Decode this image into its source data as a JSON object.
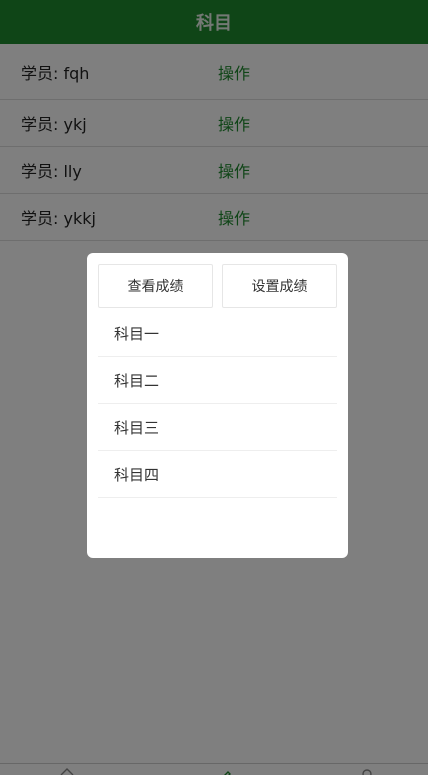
{
  "header": {
    "title": "科目"
  },
  "students": [
    {
      "name": "学员: fqh",
      "action": "操作"
    },
    {
      "name": "学员: ykj",
      "action": "操作"
    },
    {
      "name": "学员: lly",
      "action": "操作"
    },
    {
      "name": "学员: ykkj",
      "action": "操作"
    }
  ],
  "popup": {
    "buttons": {
      "view_label": "查看成绩",
      "set_label": "设置成绩"
    },
    "subjects": [
      {
        "label": "科目一"
      },
      {
        "label": "科目二"
      },
      {
        "label": "科目三"
      },
      {
        "label": "科目四"
      }
    ]
  },
  "tabbar": {
    "icons": [
      "home-icon",
      "edit-icon",
      "user-icon"
    ]
  },
  "colors": {
    "accent": "#1e8a2e",
    "overlay": "rgba(0,0,0,0.5)"
  }
}
